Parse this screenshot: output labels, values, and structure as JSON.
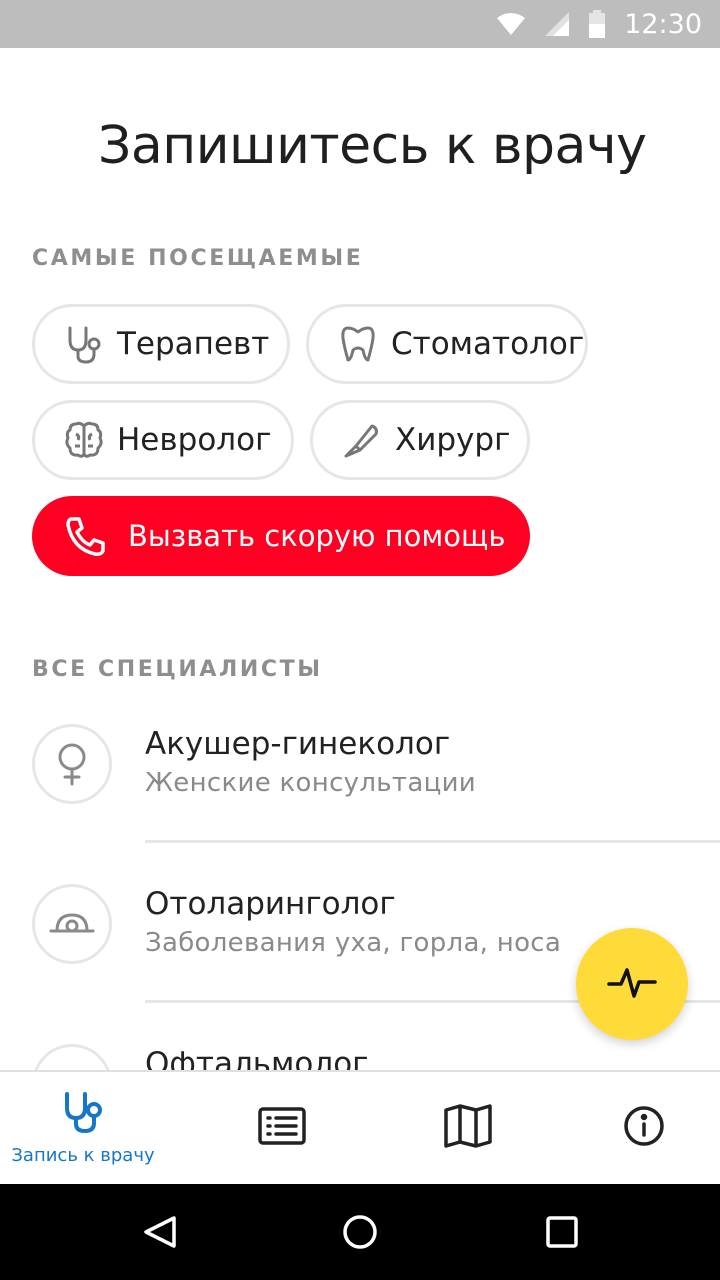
{
  "status_bar": {
    "time": "12:30",
    "icons": [
      "wifi-icon",
      "signal-icon",
      "battery-icon"
    ]
  },
  "title": "Запишитесь к врачу",
  "sections": {
    "popular_label": "САМЫЕ ПОСЕЩАЕМЫЕ",
    "all_label": "ВСЕ СПЕЦИАЛИСТЫ"
  },
  "popular": [
    {
      "label": "Терапевт",
      "icon": "stethoscope-icon"
    },
    {
      "label": "Стоматолог",
      "icon": "tooth-icon"
    },
    {
      "label": "Невролог",
      "icon": "brain-icon"
    },
    {
      "label": "Хирург",
      "icon": "scalpel-icon"
    }
  ],
  "emergency": {
    "label": "Вызвать скорую помощь",
    "icon": "phone-icon",
    "color": "#ff0022"
  },
  "specialists": [
    {
      "name": "Акушер-гинеколог",
      "desc": "Женские консультации",
      "icon": "female-icon"
    },
    {
      "name": "Отоларинголог",
      "desc": "Заболевания уха, горла, носа",
      "icon": "ent-mirror-icon"
    },
    {
      "name": "Офтальмолог",
      "desc": "",
      "icon": "eye-icon"
    }
  ],
  "fab": {
    "icon": "pulse-icon",
    "color": "#ffdb3a"
  },
  "bottom_nav": [
    {
      "label": "Запись к врачу",
      "icon": "stethoscope-icon",
      "active": true,
      "color": "#1677c9"
    },
    {
      "label": "",
      "icon": "list-icon",
      "active": false
    },
    {
      "label": "",
      "icon": "map-icon",
      "active": false
    },
    {
      "label": "",
      "icon": "info-icon",
      "active": false
    }
  ],
  "system_nav": [
    "back-icon",
    "home-icon",
    "recents-icon"
  ]
}
